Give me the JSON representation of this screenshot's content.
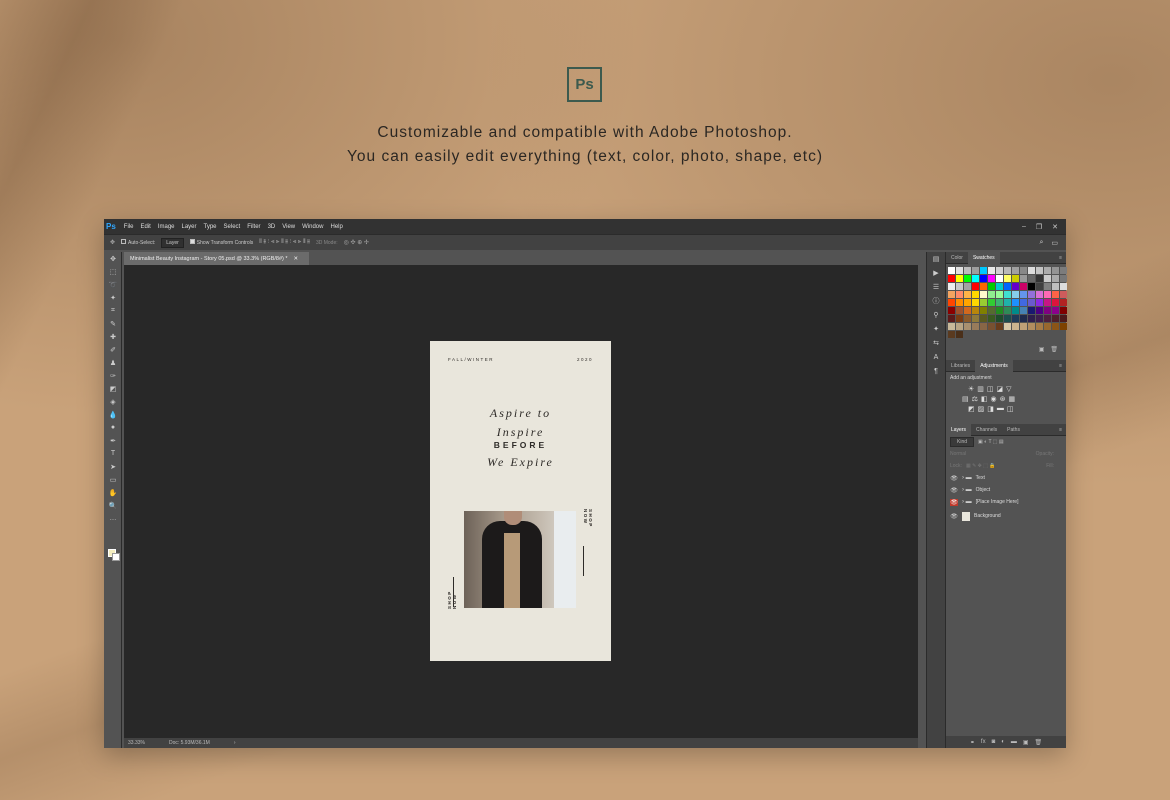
{
  "hero": {
    "logo_text": "Ps",
    "line1": "Customizable and compatible with Adobe Photoshop.",
    "line2": "You can easily edit everything (text, color, photo, shape, etc)"
  },
  "menubar": {
    "app_icon": "Ps",
    "items": [
      "File",
      "Edit",
      "Image",
      "Layer",
      "Type",
      "Select",
      "Filter",
      "3D",
      "View",
      "Window",
      "Help"
    ]
  },
  "options_bar": {
    "auto_select_label": "Auto-Select:",
    "auto_select_target": "Layer",
    "show_transform_label": "Show Transform Controls",
    "mode_label": "3D Mode:"
  },
  "document": {
    "tab_title": "Minimalist Beauty Instagram - Story 05.psd @ 33.3% (RGB/8#) *",
    "zoom": "33.33%",
    "doc_size": "Doc: 5.93M/36.1M"
  },
  "story": {
    "season": "FALL/WINTER",
    "year": "2020",
    "line1": "Aspire to",
    "line2": "Inspire",
    "line3": "BEFORE",
    "line4": "We Expire",
    "cta_right": "SHOP NOW",
    "cta_left": "SHOP NOW"
  },
  "panels": {
    "color_tabs": [
      "Color",
      "Swatches"
    ],
    "adjust_tabs": [
      "Libraries",
      "Adjustments"
    ],
    "adjust_title": "Add an adjustment",
    "layers_tabs": [
      "Layers",
      "Channels",
      "Paths"
    ],
    "kind_label": "Kind",
    "blend_mode": "Normal",
    "opacity_label": "Opacity:",
    "lock_label": "Lock:",
    "fill_label": "Fill:",
    "layers": [
      "Text",
      "Object",
      "[Place Image Here]",
      "Background"
    ]
  },
  "swatches": [
    "#ffffff",
    "#e0e0e0",
    "#bdbdbd",
    "#9e9e9e",
    "#00c8ff",
    "#e8e8e8",
    "#d0d0d0",
    "#b8b8b8",
    "#a0a0a0",
    "#888",
    "#dcdcdc",
    "#c4c4c4",
    "#acacac",
    "#949494",
    "#7c7c7c",
    "#ff0000",
    "#ffff00",
    "#00ff00",
    "#00ffff",
    "#0000ff",
    "#ff00ff",
    "#ffffff",
    "#ffff66",
    "#cccc00",
    "#999999",
    "#666666",
    "#333333",
    "#cccccc",
    "#aaaaaa",
    "#777777",
    "#ededed",
    "#c8c8c8",
    "#a3a3a3",
    "#ff0000",
    "#ff6600",
    "#00cc00",
    "#00cccc",
    "#0066ff",
    "#6600cc",
    "#cc0066",
    "#000000",
    "#404040",
    "#808080",
    "#bfbfbf",
    "#dddddd",
    "#f4a460",
    "#ff8c69",
    "#ffb347",
    "#ffd700",
    "#fffacd",
    "#90ee90",
    "#98fb98",
    "#40e0d0",
    "#87ceeb",
    "#6495ed",
    "#9370db",
    "#da70d6",
    "#ff69b4",
    "#ff6347",
    "#cd5c5c",
    "#ff4500",
    "#ff8c00",
    "#ffa500",
    "#ffd700",
    "#9acd32",
    "#32cd32",
    "#3cb371",
    "#20b2aa",
    "#1e90ff",
    "#4169e1",
    "#6a5acd",
    "#8a2be2",
    "#c71585",
    "#dc143c",
    "#b22222",
    "#8b0000",
    "#a0522d",
    "#d2691e",
    "#b8860b",
    "#808000",
    "#556b2f",
    "#228b22",
    "#2e8b57",
    "#008b8b",
    "#4682b4",
    "#191970",
    "#4b0082",
    "#800080",
    "#8b008b",
    "#800000",
    "#5c1a1a",
    "#7a3b12",
    "#8b5a2b",
    "#8f7a3a",
    "#5a5a20",
    "#3a5a20",
    "#1f4d2b",
    "#1d4d4d",
    "#1f3a5a",
    "#1f2a4d",
    "#2e1f4d",
    "#3d1f4d",
    "#4d1f3d",
    "#4d1f2a",
    "#4d1a1a",
    "#c8b99a",
    "#b8a585",
    "#a89070",
    "#987b5b",
    "#886646",
    "#785131",
    "#683c1c",
    "#d9c7a7",
    "#ccb48f",
    "#bfa177",
    "#b28e5f",
    "#a57b47",
    "#98682f",
    "#8b5517",
    "#7e4200",
    "#5a3a1f",
    "#4a2f19"
  ],
  "layout_note_colors": {
    "accent": "#31a8ff",
    "selected_eye": "#c0392b"
  }
}
